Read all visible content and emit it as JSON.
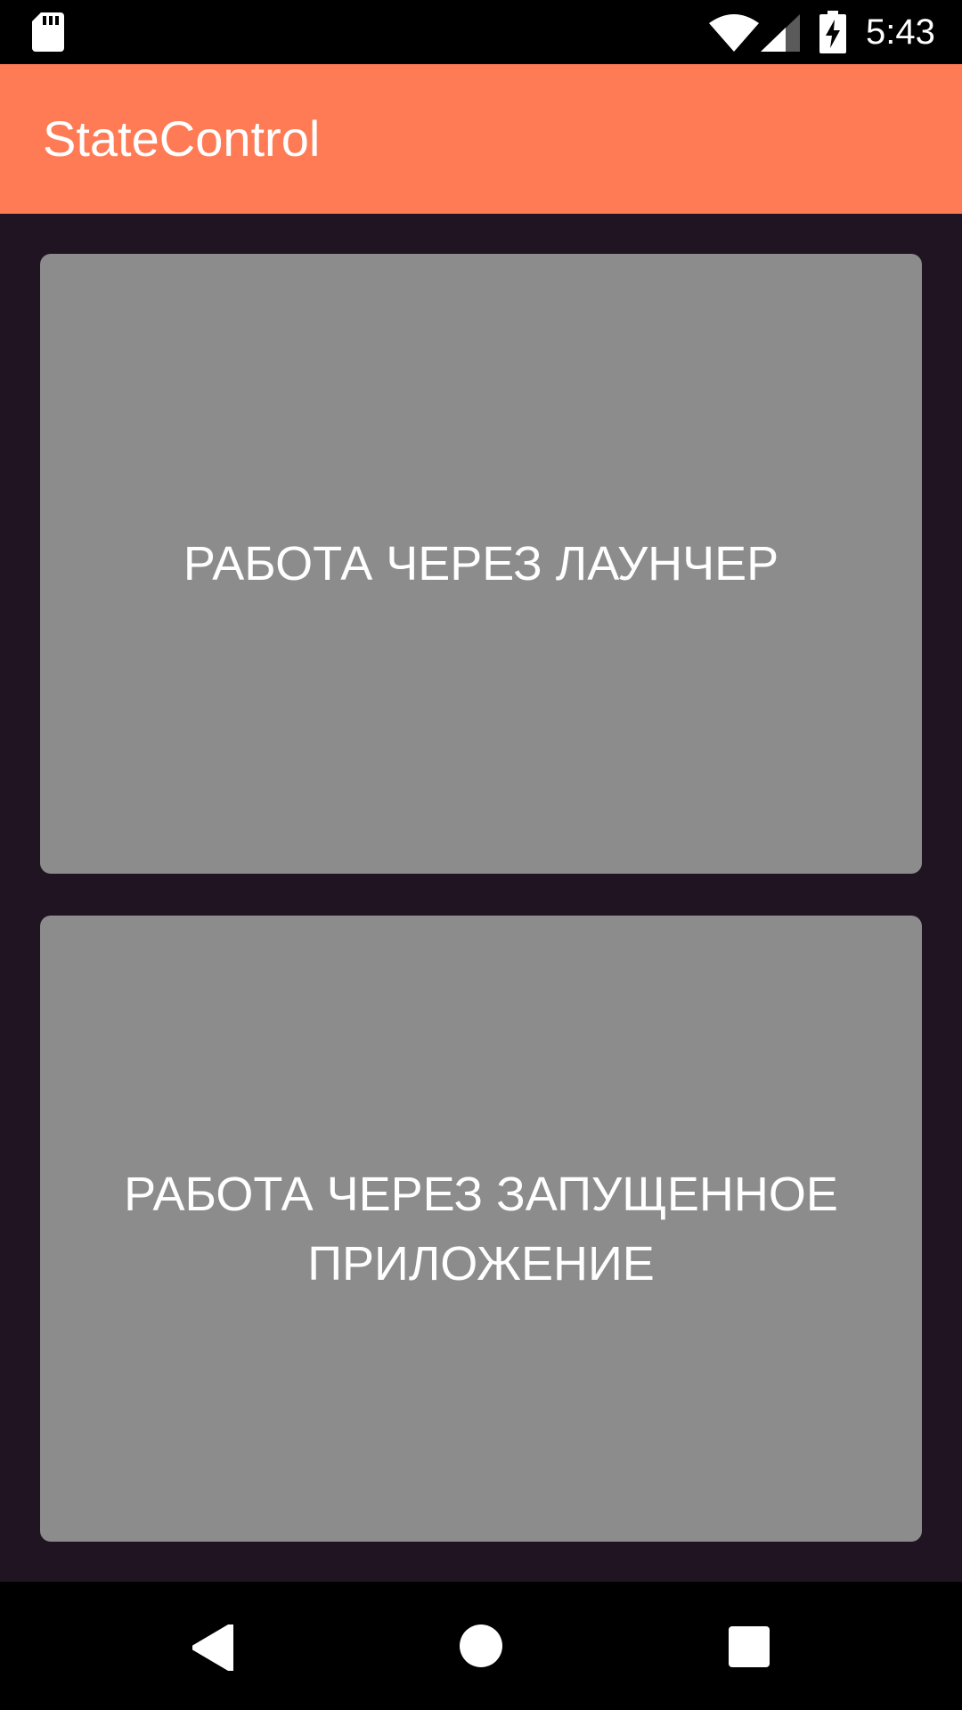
{
  "status_bar": {
    "time": "5:43",
    "icons": [
      "sd-card-icon",
      "wifi-icon",
      "signal-icon",
      "battery-charging-icon"
    ]
  },
  "app_bar": {
    "title": "StateControl",
    "color": "#ff7b55"
  },
  "main": {
    "background": "#201422",
    "buttons": [
      {
        "label": "РАБОТА ЧЕРЕЗ ЛАУНЧЕР"
      },
      {
        "label": "РАБОТА ЧЕРЕЗ ЗАПУЩЕННОЕ ПРИЛОЖЕНИЕ"
      }
    ],
    "button_color": "#8c8c8c"
  },
  "nav_bar": {
    "icons": [
      "back-icon",
      "home-icon",
      "recents-icon"
    ]
  }
}
